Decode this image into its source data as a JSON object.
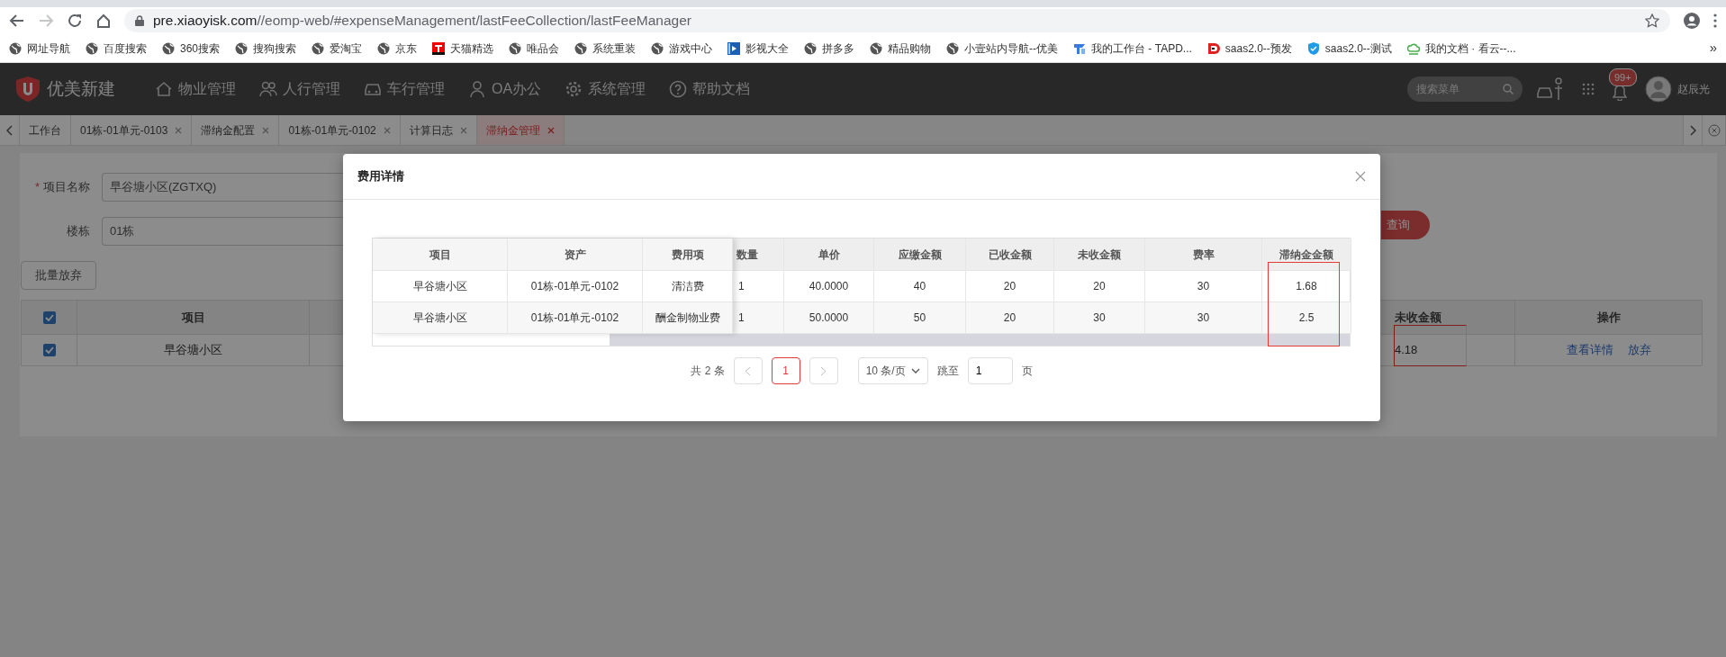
{
  "browser": {
    "url_host": "pre.xiaoyisk.com",
    "url_path": "//eomp-web/#expenseManagement/lastFeeCollection/lastFeeManager",
    "forward_disabled": true,
    "bookmarks": [
      {
        "label": "网址导航",
        "kind": "globe"
      },
      {
        "label": "百度搜索",
        "kind": "globe"
      },
      {
        "label": "360搜索",
        "kind": "globe"
      },
      {
        "label": "搜狗搜索",
        "kind": "globe"
      },
      {
        "label": "爱淘宝",
        "kind": "globe"
      },
      {
        "label": "京东",
        "kind": "globe"
      },
      {
        "label": "天猫精选",
        "kind": "letter-tile"
      },
      {
        "label": "唯品会",
        "kind": "globe"
      },
      {
        "label": "系统重装",
        "kind": "globe"
      },
      {
        "label": "游戏中心",
        "kind": "globe"
      },
      {
        "label": "影视大全",
        "kind": "film"
      },
      {
        "label": "拼多多",
        "kind": "globe"
      },
      {
        "label": "精品购物",
        "kind": "globe"
      },
      {
        "label": "小壹站内导航--优美",
        "kind": "globe"
      },
      {
        "label": "我的工作台 - TAPD...",
        "kind": "tile"
      },
      {
        "label": "saas2.0--预发",
        "kind": "disc"
      },
      {
        "label": "saas2.0--测试",
        "kind": "shield"
      },
      {
        "label": "我的文档 · 看云--...",
        "kind": "cloud"
      }
    ],
    "overflow": "»"
  },
  "app": {
    "logo": "优美新建",
    "nav": [
      {
        "label": "物业管理",
        "kind": "house"
      },
      {
        "label": "人行管理",
        "kind": "people"
      },
      {
        "label": "车行管理",
        "kind": "car"
      },
      {
        "label": "OA办公",
        "kind": "person"
      },
      {
        "label": "系统管理",
        "kind": "gear"
      },
      {
        "label": "帮助文档",
        "kind": "help"
      }
    ],
    "search": {
      "placeholder": "搜索菜单"
    },
    "notifications": "99+",
    "user": "赵辰光"
  },
  "tabs": [
    {
      "label": "工作台",
      "closable": false,
      "selected": false
    },
    {
      "label": "01栋-01单元-0103",
      "closable": true,
      "selected": false
    },
    {
      "label": "滞纳金配置",
      "closable": true,
      "selected": false
    },
    {
      "label": "01栋-01单元-0102",
      "closable": true,
      "selected": false
    },
    {
      "label": "计算日志",
      "closable": true,
      "selected": false
    },
    {
      "label": "滞纳金管理",
      "closable": true,
      "selected": true
    }
  ],
  "filters": [
    {
      "label": "项目名称",
      "required_mark": "*",
      "value": "早谷塘小区(ZGTXQ)"
    },
    {
      "label": "楼栋",
      "value": "01栋"
    }
  ],
  "query_button": "查询",
  "bulk_button": "批量放弃",
  "table": {
    "all_checked": true,
    "columns": [
      "项目",
      "未收金额",
      "操作"
    ],
    "rows": [
      {
        "checked": true,
        "project": "早谷塘小区",
        "unpaid": "4.18",
        "unpaid_annotated": true,
        "actions": [
          "查看详情",
          "放弃"
        ]
      }
    ]
  },
  "modal": {
    "title": "费用详情",
    "columns": [
      {
        "label": "项目",
        "fixed": true,
        "annotated": false
      },
      {
        "label": "资产",
        "fixed": true,
        "annotated": false
      },
      {
        "label": "费用项",
        "fixed": true,
        "annotated": false
      },
      {
        "label": "数量",
        "fixed": false,
        "annotated": false
      },
      {
        "label": "单价",
        "fixed": false,
        "annotated": false
      },
      {
        "label": "应缴金额",
        "fixed": false,
        "annotated": false
      },
      {
        "label": "已收金额",
        "fixed": false,
        "annotated": false
      },
      {
        "label": "未收金额",
        "fixed": false,
        "annotated": false
      },
      {
        "label": "费率",
        "fixed": false,
        "annotated": false
      },
      {
        "label": "滞纳金金额",
        "fixed": false,
        "annotated": true
      }
    ],
    "rows": [
      {
        "cells": [
          "早谷塘小区",
          "01栋-01单元-0102",
          "清洁费",
          "1",
          "40.0000",
          "40",
          "20",
          "20",
          "30",
          "1.68"
        ]
      },
      {
        "cells": [
          "早谷塘小区",
          "01栋-01单元-0102",
          "酬金制物业费",
          "1",
          "50.0000",
          "50",
          "20",
          "30",
          "30",
          "2.5"
        ]
      }
    ],
    "pagination": {
      "total": "共 2 条",
      "prev_disabled": true,
      "next_disabled": true,
      "pages": [
        {
          "label": "1",
          "selected": true
        }
      ],
      "page_size": "10 条/页",
      "jump_label": "跳至",
      "jump_value": "1",
      "page_suffix": "页"
    }
  }
}
